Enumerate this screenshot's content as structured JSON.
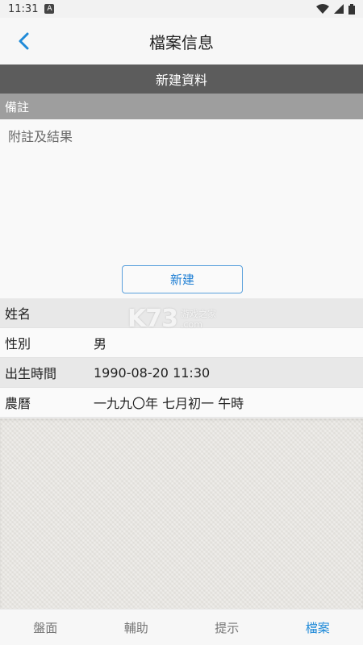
{
  "status": {
    "time": "11:31",
    "notif_glyph": "A",
    "icons": [
      "wifi-icon",
      "signal-icon",
      "battery-icon"
    ]
  },
  "header": {
    "title": "檔案信息",
    "back_icon": "chevron-left-icon"
  },
  "section": {
    "title": "新建資料"
  },
  "notes": {
    "label": "備註",
    "placeholder": "附註及結果",
    "value": ""
  },
  "actions": {
    "new_label": "新建"
  },
  "profile": {
    "rows": [
      {
        "label": "姓名",
        "value": ""
      },
      {
        "label": "性別",
        "value": "男"
      },
      {
        "label": "出生時間",
        "value": "1990-08-20 11:30"
      },
      {
        "label": "農曆",
        "value": "一九九〇年 七月初一 午時"
      }
    ]
  },
  "watermark": {
    "logo": "K73",
    "line1": "游戏之家",
    "line2": ".com"
  },
  "nav": {
    "tabs": [
      {
        "label": "盤面",
        "active": false
      },
      {
        "label": "輔助",
        "active": false
      },
      {
        "label": "提示",
        "active": false
      },
      {
        "label": "檔案",
        "active": true
      }
    ]
  },
  "colors": {
    "accent": "#1f8ad8",
    "section_bar": "#5c5c5c",
    "notes_header": "#9e9e9e"
  }
}
